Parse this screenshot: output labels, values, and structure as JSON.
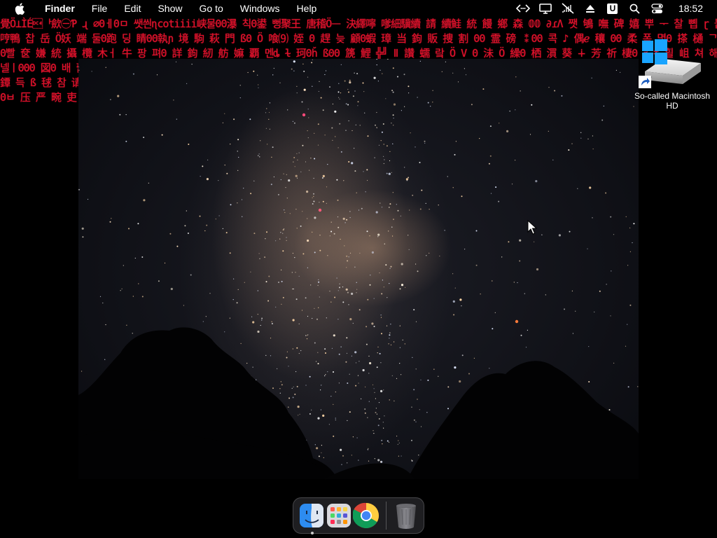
{
  "menubar": {
    "apple_icon": "apple-icon",
    "items": [
      "Finder",
      "File",
      "Edit",
      "Show",
      "Go to",
      "Windows",
      "Help"
    ],
    "status_icons": [
      "remote-desktop-icon",
      "display-icon",
      "mute-icon",
      "eject-icon",
      "u-badge-icon",
      "search-icon",
      "control-center-icon"
    ],
    "u_badge": "U",
    "clock": "18:52"
  },
  "glitch_lines": [
    "覺Ö⊥ÌÉ\u0014ᅡ歛㊀Ƥ ɻ ∅0ㅔ0ㅁ 쌧씐ɳcotiiii峡물00瀑 칙0鍙 뻥聚王 唐稽Öᅳ 決繹嚀 嗲細驥續 請 續鮭 統 饅 鄉 森 𝟘𝟘 ∂ɾɅ 쨋 鴝 嘸 碑 嬉 뿌 ᅮ 찰 뼵 ɽ 붙 創 텔 깐 곤",
    "哼鴨 찹 岳 Ö妖 端 둘0跑 딩 睛00執ɲ 境 駒 萩 門 ß0 Ö 喰⑼ 姪 0 趕 늦 顧0蝦 璋 当 鉤 販 捜 割 00 霊 磅 ⁑00 콕 ♪ 偶ℯ 穰 00 柔 폭 몇0 搽 樋 ᄀ 系 汉0 汝 ⅄ 0 ⅆ 一 뮟 娲",
    "0빨 奁 嫌 統 攝 欖 木ㅓ 牛 팡 펴0 詳 鉤 紉 舫 嫲 覇 멘ȡ ɫ 珂0ȟ ß00 篪 鯉 ╬╝ ǁ 讚 蠕 랔 Ö V 0 沬 Ö 繰0 栖 㵋 葵 ∔ 芳 祈 棲0 ǥ ǂ 흴 岨 쳐 해 ᅩ 製 흰 ᅴ 新 逆",
    "넬ㅣ000 図0 배 蕾",
    "鐔 득 ß 毬 참 请 餐",
    "0ㅂ 压 严 畹 吏 鮭"
  ],
  "desktop": {
    "disk_label": "So-called Macintosh HD",
    "disk_icon": "hard-drive-icon",
    "overlay_icon": "windows-logo-icon",
    "alias_icon": "alias-arrow-icon"
  },
  "wallpaper": {
    "description_icon": "milky-way-wallpaper"
  },
  "dock": {
    "items": [
      {
        "name": "Finder",
        "icon": "finder-icon",
        "running": true
      },
      {
        "name": "Launchpad",
        "icon": "launchpad-icon",
        "running": false
      },
      {
        "name": "Google Chrome",
        "icon": "chrome-icon",
        "running": false
      },
      {
        "name": "Trash",
        "icon": "trash-icon",
        "running": false
      }
    ]
  }
}
